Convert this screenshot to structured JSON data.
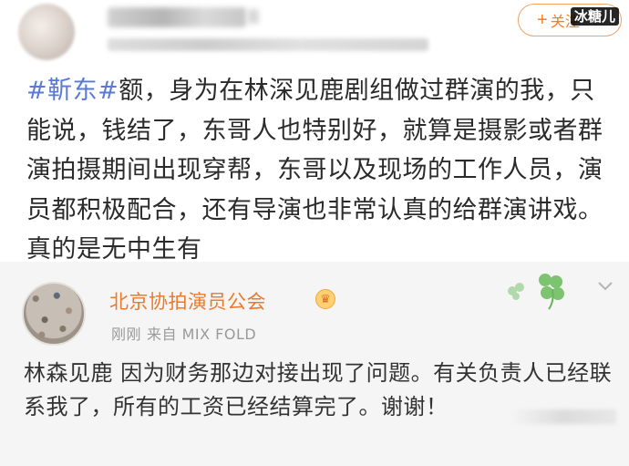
{
  "post1": {
    "follow_label": "关注",
    "follow_plus": "+",
    "watermark": "冰糖儿",
    "hashtag": "#靳东#",
    "text": "额，身为在林深见鹿剧组做过群演的我，只能说，钱结了，东哥人也特别好，就算是摄影或者群演拍摄期间出现穿帮，东哥以及现场的工作人员，演员都积极配合，还有导演也非常认真的给群演讲戏。真的是无中生有"
  },
  "post2": {
    "author": "北京协拍演员公会",
    "time": "刚刚",
    "source": "来自 MIX FOLD",
    "text": "林森见鹿 因为财务那边对接出现了问题。有关负责人已经联系我了，所有的工资已经结算完了。谢谢！"
  },
  "icons": {
    "crown": "crown-icon",
    "clover": "clover-icon",
    "chevron": "chevron-down-icon"
  },
  "colors": {
    "hashtag": "#5a7ad6",
    "follow": "#ff7a1a",
    "author": "#ea7a2e",
    "meta": "#9a9a9a"
  }
}
